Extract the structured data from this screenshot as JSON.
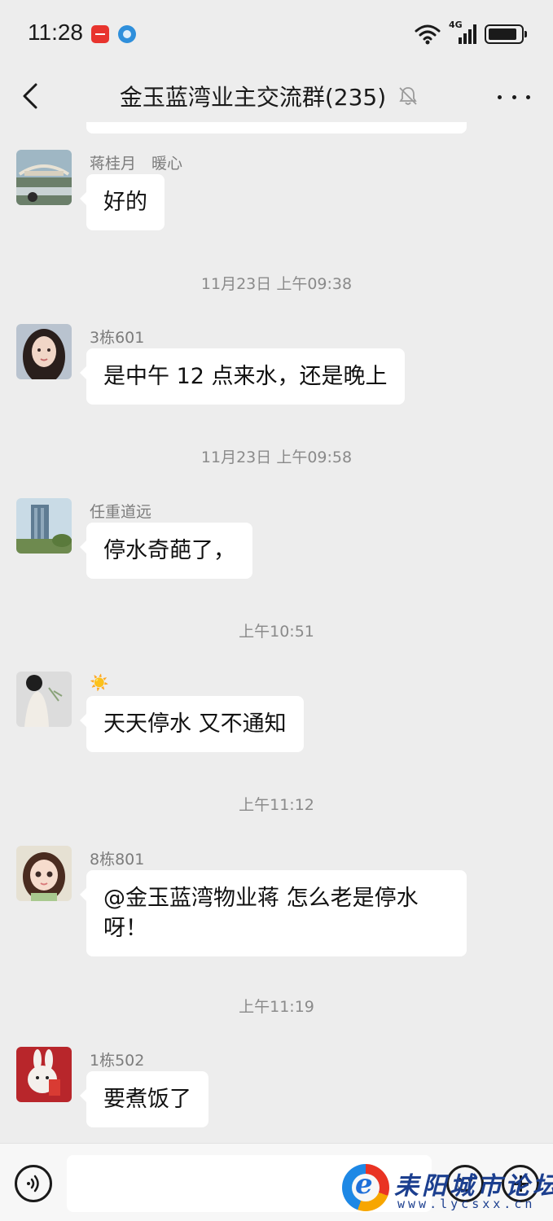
{
  "status_bar": {
    "time": "11:28",
    "network": "4G",
    "icons": [
      "huawei-app-icon",
      "browser-app-icon",
      "wifi-icon",
      "cellular-signal-icon",
      "battery-icon"
    ]
  },
  "header": {
    "title": "金玉蓝湾业主交流群(235)",
    "icons": [
      "back-arrow-icon",
      "mute-bell-icon",
      "more-dots-icon"
    ]
  },
  "messages": [
    {
      "sender": "蒋桂月　暖心",
      "text": "好的",
      "avatar": "bridge-photo-avatar"
    },
    {
      "sender": "3栋601",
      "text": "是中午 12 点来水，还是晚上",
      "avatar": "girl-portrait-avatar"
    },
    {
      "sender": "任重道远",
      "text": "停水奇葩了，",
      "avatar": "building-photo-avatar"
    },
    {
      "sender": "☀️",
      "text": "天天停水  又不通知",
      "avatar": "woman-back-avatar"
    },
    {
      "sender": "8栋801",
      "text": "@金玉蓝湾物业蒋  怎么老是停水呀！",
      "avatar": "cartoon-girl-avatar"
    },
    {
      "sender": "1栋502",
      "text": "要煮饭了",
      "avatar": "bunny-avatar"
    }
  ],
  "timestamps": [
    "11月23日 上午09:38",
    "11月23日 上午09:58",
    "上午10:51",
    "上午11:12",
    "上午11:19"
  ],
  "watermark": {
    "title": "耒阳城市论坛",
    "url": "www.lycsxx.cn"
  },
  "colors": {
    "background": "#ededed",
    "bubble": "#ffffff",
    "meta_text": "#8a8a8a"
  }
}
